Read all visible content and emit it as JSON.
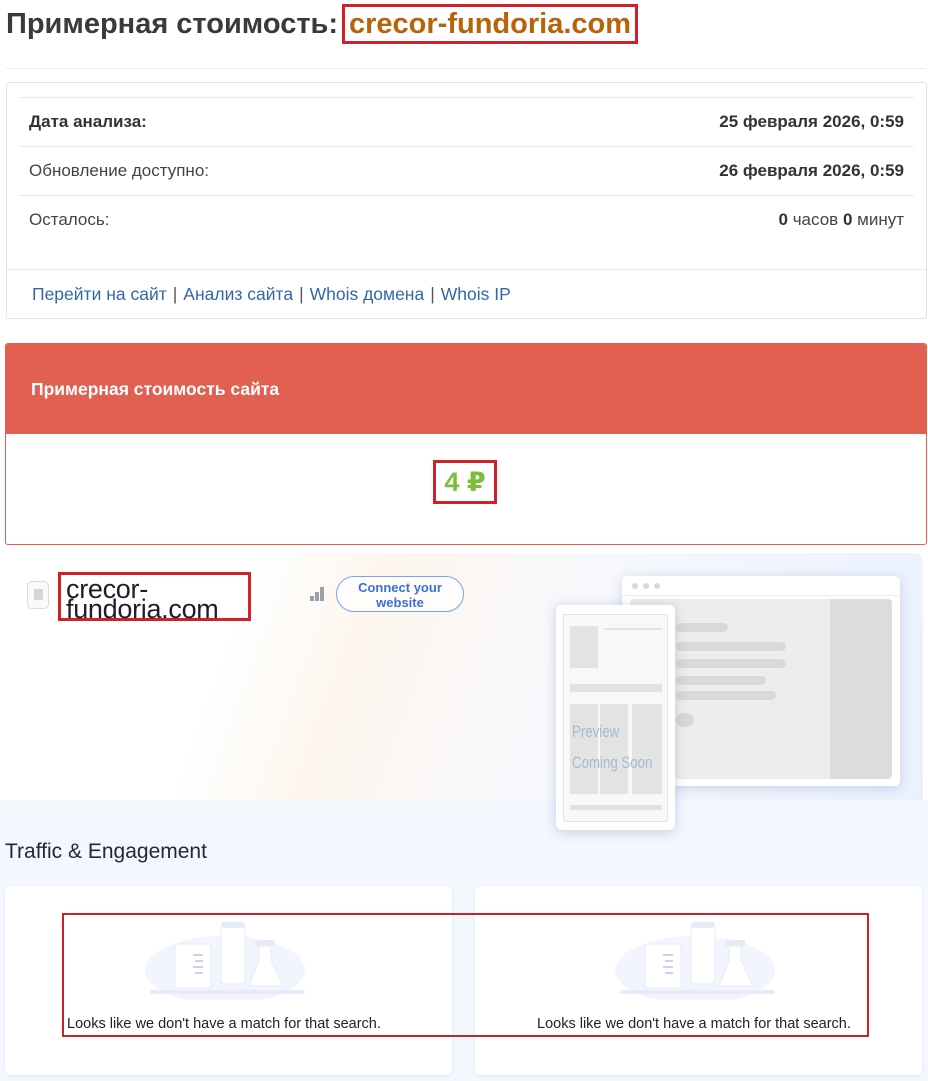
{
  "header": {
    "title_prefix": "Примерная стоимость:",
    "domain": "crecor-fundoria.com"
  },
  "analysis": {
    "date_label": "Дата анализа:",
    "date_value": "25 февраля 2026, 0:59",
    "update_label": "Обновление доступно:",
    "update_value": "26 февраля 2026, 0:59",
    "remaining_label": "Осталось:",
    "remaining_hours": "0",
    "hours_unit": "часов",
    "remaining_minutes": "0",
    "minutes_unit": "минут"
  },
  "links": {
    "goto_site": "Перейти на сайт",
    "site_analysis": "Анализ сайта",
    "whois_domain": "Whois домена",
    "whois_ip": "Whois IP",
    "separator": "|"
  },
  "cost": {
    "header": "Примерная стоимость сайта",
    "value": "4 ₽"
  },
  "preview": {
    "domain_line1": "crecor-",
    "domain_line2": "fundoria.com",
    "connect_button": "Connect your website",
    "placeholder_line1": "Preview",
    "placeholder_line2": "Coming Soon"
  },
  "traffic": {
    "section_title": "Traffic & Engagement",
    "empty_message_left": "Looks like we don't have a match for that search.",
    "empty_message_right": "Looks like we don't have a match for that search."
  },
  "colors": {
    "domain_title": "#b8630a",
    "cost_header_bg": "#e26052",
    "cost_value": "#7cbe3c",
    "link": "#3367a8",
    "highlight": "#d0202a"
  }
}
